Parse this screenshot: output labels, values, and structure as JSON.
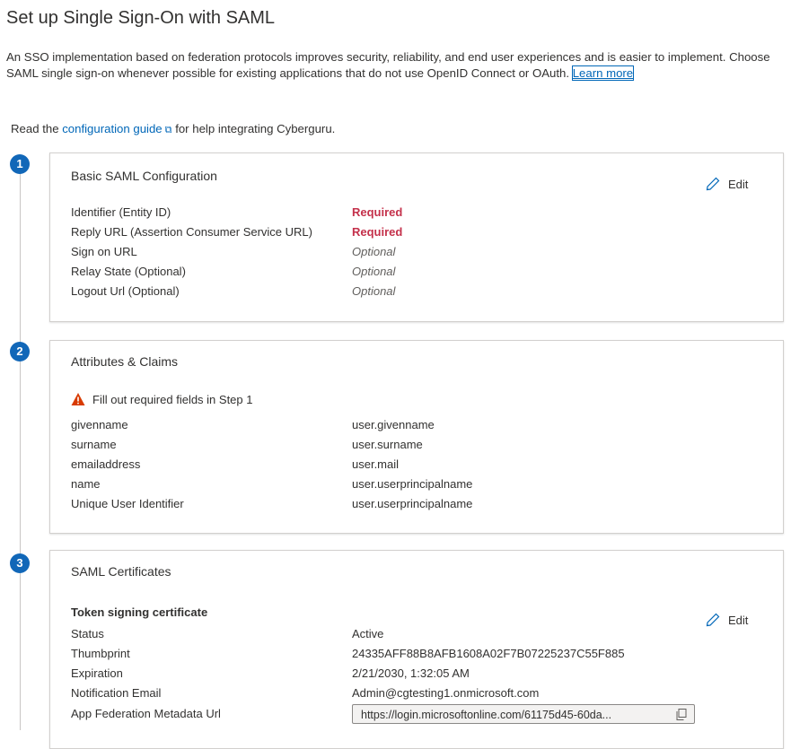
{
  "header": {
    "title": "Set up Single Sign-On with SAML",
    "intro_text": "An SSO implementation based on federation protocols improves security, reliability, and end user experiences and is easier to implement. Choose SAML single sign-on whenever possible for existing applications that do not use OpenID Connect or OAuth.",
    "learn_more_link": "Learn more",
    "guide_prefix": "Read the",
    "guide_link": "configuration guide",
    "guide_suffix": "for help integrating Cyberguru."
  },
  "steps": {
    "step1": {
      "number": "1",
      "title": "Basic SAML Configuration",
      "edit_label": "Edit",
      "rows": [
        {
          "label": "Identifier (Entity ID)",
          "value": "Required"
        },
        {
          "label": "Reply URL (Assertion Consumer Service URL)",
          "value": "Required"
        },
        {
          "label": "Sign on URL",
          "value": "Optional"
        },
        {
          "label": "Relay State (Optional)",
          "value": "Optional"
        },
        {
          "label": "Logout Url (Optional)",
          "value": "Optional"
        }
      ]
    },
    "step2": {
      "number": "2",
      "title": "Attributes & Claims",
      "warning": "Fill out required fields in Step 1",
      "rows": [
        {
          "label": "givenname",
          "value": "user.givenname"
        },
        {
          "label": "surname",
          "value": "user.surname"
        },
        {
          "label": "emailaddress",
          "value": "user.mail"
        },
        {
          "label": "name",
          "value": "user.userprincipalname"
        },
        {
          "label": "Unique User Identifier",
          "value": "user.userprincipalname"
        }
      ]
    },
    "step3": {
      "number": "3",
      "title": "SAML Certificates",
      "edit_label": "Edit",
      "subheading": "Token signing certificate",
      "rows": [
        {
          "label": "Status",
          "value": "Active"
        },
        {
          "label": "Thumbprint",
          "value": "24335AFF88B8AFB1608A02F7B07225237C55F885"
        },
        {
          "label": "Expiration",
          "value": "2/21/2030, 1:32:05 AM"
        },
        {
          "label": "Notification Email",
          "value": "Admin@cgtesting1.onmicrosoft.com"
        },
        {
          "label": "App Federation Metadata Url",
          "value": "https://login.microsoftonline.com/61175d45-60da..."
        }
      ]
    }
  },
  "colors": {
    "accent": "#1167b8",
    "required": "#c4314b",
    "warning": "#d83b01"
  }
}
